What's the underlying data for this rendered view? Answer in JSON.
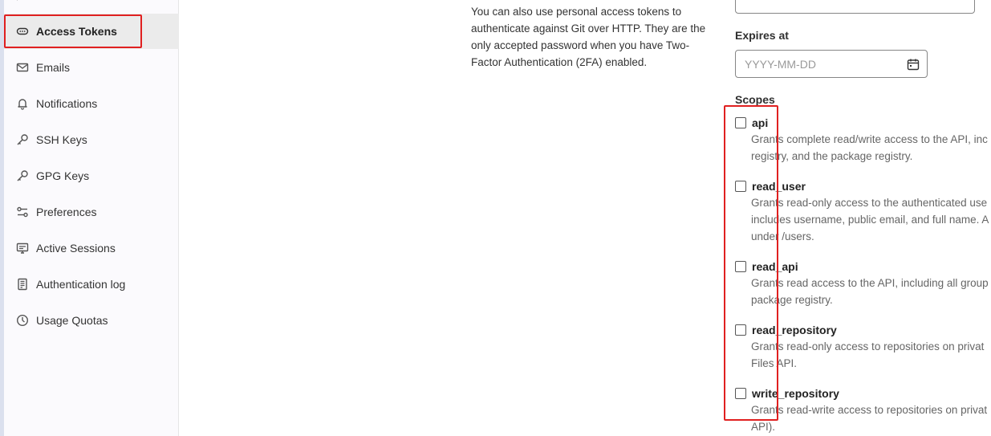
{
  "sidebar": {
    "items": [
      {
        "label": "Access Tokens",
        "icon": "token-icon",
        "active": true
      },
      {
        "label": "Emails",
        "icon": "envelope-icon"
      },
      {
        "label": "Notifications",
        "icon": "bell-icon"
      },
      {
        "label": "SSH Keys",
        "icon": "key-icon"
      },
      {
        "label": "GPG Keys",
        "icon": "key-icon"
      },
      {
        "label": "Preferences",
        "icon": "preferences-icon"
      },
      {
        "label": "Active Sessions",
        "icon": "monitor-icon"
      },
      {
        "label": "Authentication log",
        "icon": "log-icon"
      },
      {
        "label": "Usage Quotas",
        "icon": "quota-icon"
      }
    ]
  },
  "help": {
    "text": "You can also use personal access tokens to authenticate against Git over HTTP. They are the only accepted password when you have Two-Factor Authentication (2FA) enabled."
  },
  "form": {
    "expires_label": "Expires at",
    "expires_placeholder": "YYYY-MM-DD",
    "scopes_label": "Scopes",
    "scopes": [
      {
        "name": "api",
        "checked": false,
        "description": "Grants complete read/write access to the API, inc\nregistry, and the package registry."
      },
      {
        "name": "read_user",
        "checked": false,
        "description": "Grants read-only access to the authenticated use\nincludes username, public email, and full name. A\nunder /users."
      },
      {
        "name": "read_api",
        "checked": false,
        "description": "Grants read access to the API, including all group\npackage registry."
      },
      {
        "name": "read_repository",
        "checked": false,
        "description": "Grants read-only access to repositories on privat\nFiles API."
      },
      {
        "name": "write_repository",
        "checked": false,
        "description": "Grants read-write access to repositories on privat\nAPI)."
      }
    ]
  },
  "colors": {
    "highlight": "#e02020",
    "active_bg": "#ebebeb",
    "sidebar_bg": "#fbfafd"
  }
}
